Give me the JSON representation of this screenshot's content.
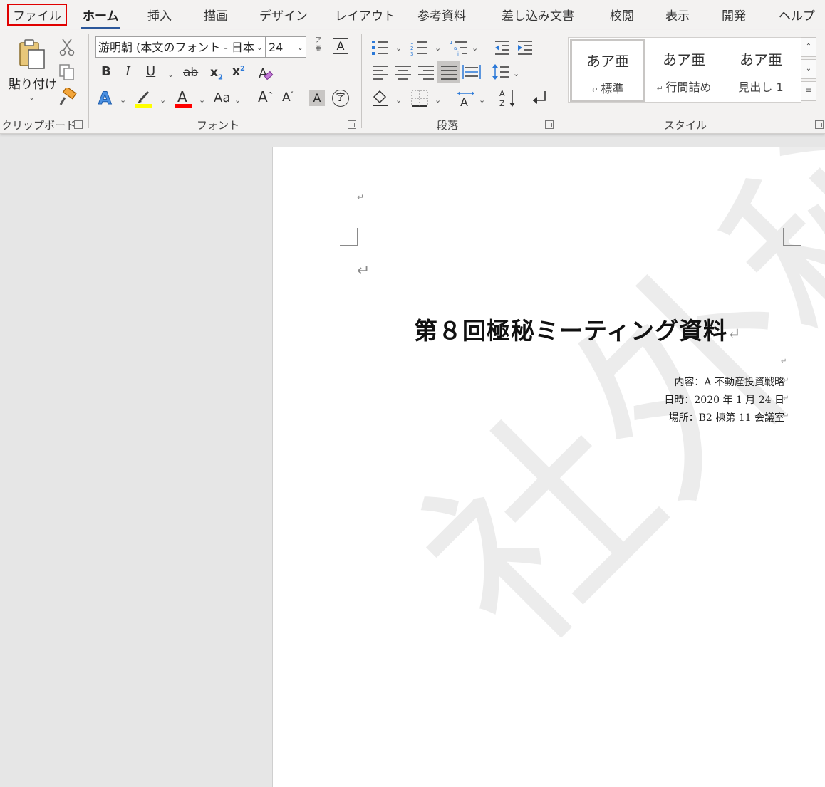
{
  "tabs": {
    "file": "ファイル",
    "home": "ホーム",
    "insert": "挿入",
    "draw": "描画",
    "design": "デザイン",
    "layout": "レイアウト",
    "references": "参考資料",
    "mailings": "差し込み文書",
    "review": "校閲",
    "view": "表示",
    "developer": "開発",
    "help": "ヘルプ"
  },
  "clipboard": {
    "paste_label": "貼り付け",
    "group_label": "クリップボード"
  },
  "font": {
    "font_name": "游明朝 (本文のフォント - 日本",
    "font_size": "24",
    "group_label": "フォント",
    "furigana_top": "ア",
    "furigana_bottom": "亜",
    "bold": "B",
    "italic": "I",
    "underline": "U",
    "strike": "ab",
    "subscript": "x",
    "subscript_mark": "2",
    "superscript": "x",
    "superscript_mark": "2",
    "text_effect": "A",
    "font_color": "A",
    "change_case": "Aa",
    "grow": "A",
    "shrink": "A",
    "char_shading": "A",
    "enclose": "字",
    "border_char": "A"
  },
  "paragraph": {
    "group_label": "段落"
  },
  "styles": {
    "group_label": "スタイル",
    "items": [
      {
        "sample": "あア亜",
        "name": "標準"
      },
      {
        "sample": "あア亜",
        "name": "行間詰め"
      },
      {
        "sample": "あア亜",
        "name": "見出し 1"
      }
    ]
  },
  "document": {
    "title": "第８回極秘ミーティング資料",
    "info_lines": [
      "内容：A 不動産投資戦略",
      "日時：2020 年 1 月 24 日",
      "場所：B2 棟第 11 会議室"
    ],
    "watermark": "社外秘"
  },
  "colors": {
    "active_tab_underline": "#2b579a",
    "file_tab_highlight": "#e00000",
    "highlight_yellow": "#ffff00",
    "font_color_red": "#ff0000",
    "ribbon_background": "#f3f2f1"
  }
}
